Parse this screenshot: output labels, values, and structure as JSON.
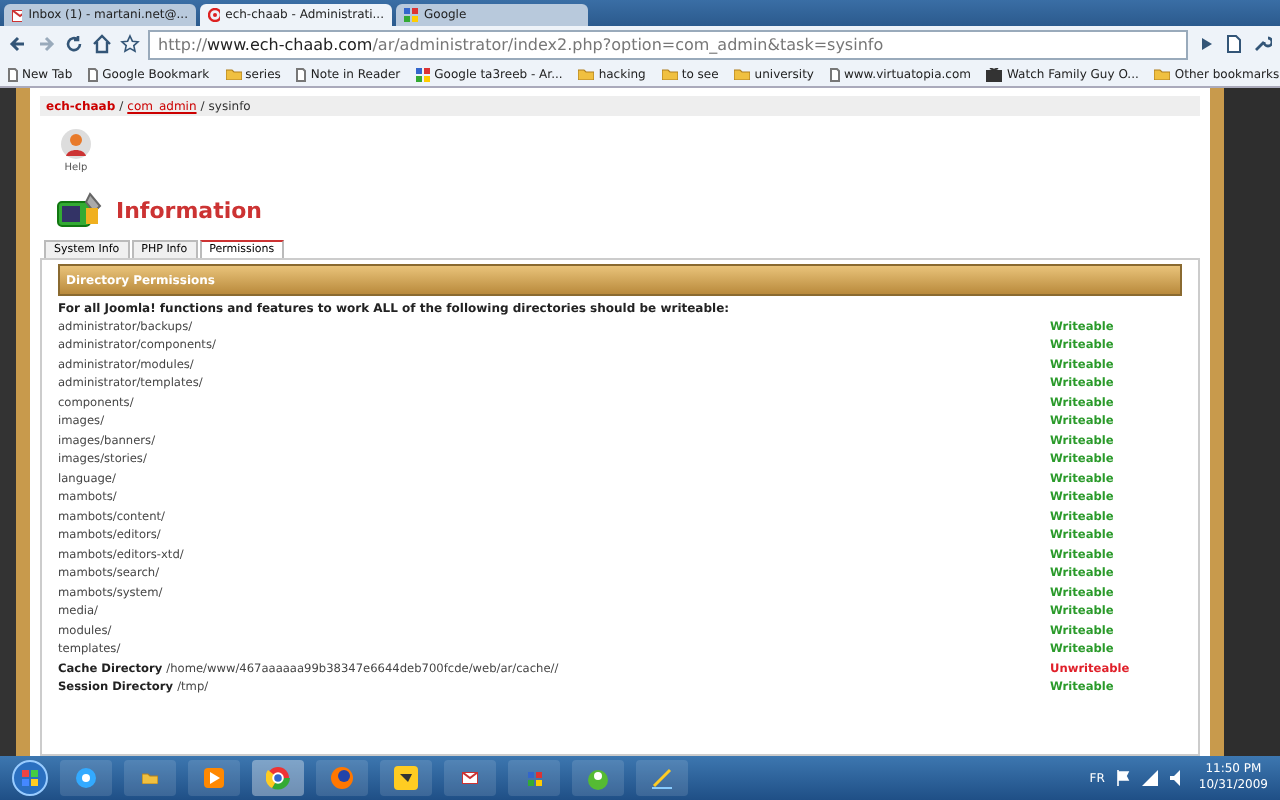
{
  "browser_tabs": [
    {
      "title": "Inbox (1) - martani.net@...",
      "kind": "mail",
      "selected": false
    },
    {
      "title": "ech-chaab - Administrati...",
      "kind": "site",
      "selected": true
    },
    {
      "title": "Google",
      "kind": "google",
      "selected": false
    }
  ],
  "address": {
    "scheme": "http://",
    "host": "www.ech-chaab.com",
    "path": "/ar/administrator/index2.php?option=com_admin&task=sysinfo"
  },
  "bookmarks": [
    {
      "label": "New Tab",
      "kind": "page"
    },
    {
      "label": "Google Bookmark",
      "kind": "page"
    },
    {
      "label": "series",
      "kind": "folder"
    },
    {
      "label": "Note in Reader",
      "kind": "page"
    },
    {
      "label": "Google ta3reeb - Ar...",
      "kind": "google"
    },
    {
      "label": "hacking",
      "kind": "folder"
    },
    {
      "label": "to see",
      "kind": "folder"
    },
    {
      "label": "university",
      "kind": "folder"
    },
    {
      "label": "www.virtuatopia.com",
      "kind": "page"
    },
    {
      "label": "Watch Family Guy O...",
      "kind": "tv"
    }
  ],
  "other_bookmarks": "Other bookmarks",
  "breadcrumb": [
    {
      "label": "ech-chaab",
      "kind": "site"
    },
    {
      "label": "/",
      "kind": "sep"
    },
    {
      "label": "com_admin",
      "kind": "link"
    },
    {
      "label": "/",
      "kind": "sep"
    },
    {
      "label": "sysinfo",
      "kind": "current"
    }
  ],
  "help_label": "Help",
  "heading": "Information",
  "tabs": [
    {
      "label": "System Info",
      "selected": false
    },
    {
      "label": "PHP Info",
      "selected": false
    },
    {
      "label": "Permissions",
      "selected": true
    }
  ],
  "section_title": "Directory Permissions",
  "intro": "For all Joomla! functions and features to work ALL of the following directories should be writeable:",
  "rows": [
    {
      "path": "administrator/backups/",
      "status": "Writeable",
      "writeable": true
    },
    {
      "path": "administrator/components/",
      "status": "Writeable",
      "writeable": true
    },
    {
      "path": "administrator/modules/",
      "status": "Writeable",
      "writeable": true
    },
    {
      "path": "administrator/templates/",
      "status": "Writeable",
      "writeable": true
    },
    {
      "path": "components/",
      "status": "Writeable",
      "writeable": true
    },
    {
      "path": "images/",
      "status": "Writeable",
      "writeable": true
    },
    {
      "path": "images/banners/",
      "status": "Writeable",
      "writeable": true
    },
    {
      "path": "images/stories/",
      "status": "Writeable",
      "writeable": true
    },
    {
      "path": "language/",
      "status": "Writeable",
      "writeable": true
    },
    {
      "path": "mambots/",
      "status": "Writeable",
      "writeable": true
    },
    {
      "path": "mambots/content/",
      "status": "Writeable",
      "writeable": true
    },
    {
      "path": "mambots/editors/",
      "status": "Writeable",
      "writeable": true
    },
    {
      "path": "mambots/editors-xtd/",
      "status": "Writeable",
      "writeable": true
    },
    {
      "path": "mambots/search/",
      "status": "Writeable",
      "writeable": true
    },
    {
      "path": "mambots/system/",
      "status": "Writeable",
      "writeable": true
    },
    {
      "path": "media/",
      "status": "Writeable",
      "writeable": true
    },
    {
      "path": "modules/",
      "status": "Writeable",
      "writeable": true
    },
    {
      "path": "templates/",
      "status": "Writeable",
      "writeable": true
    },
    {
      "label": "Cache Directory",
      "path": "/home/www/467aaaaaa99b38347e6644deb700fcde/web/ar/cache//",
      "status": "Unwriteable",
      "writeable": false
    },
    {
      "label": "Session Directory",
      "path": "/tmp/",
      "status": "Writeable",
      "writeable": true
    }
  ],
  "tray": {
    "language": "FR",
    "time": "11:50 PM",
    "date": "10/31/2009"
  }
}
